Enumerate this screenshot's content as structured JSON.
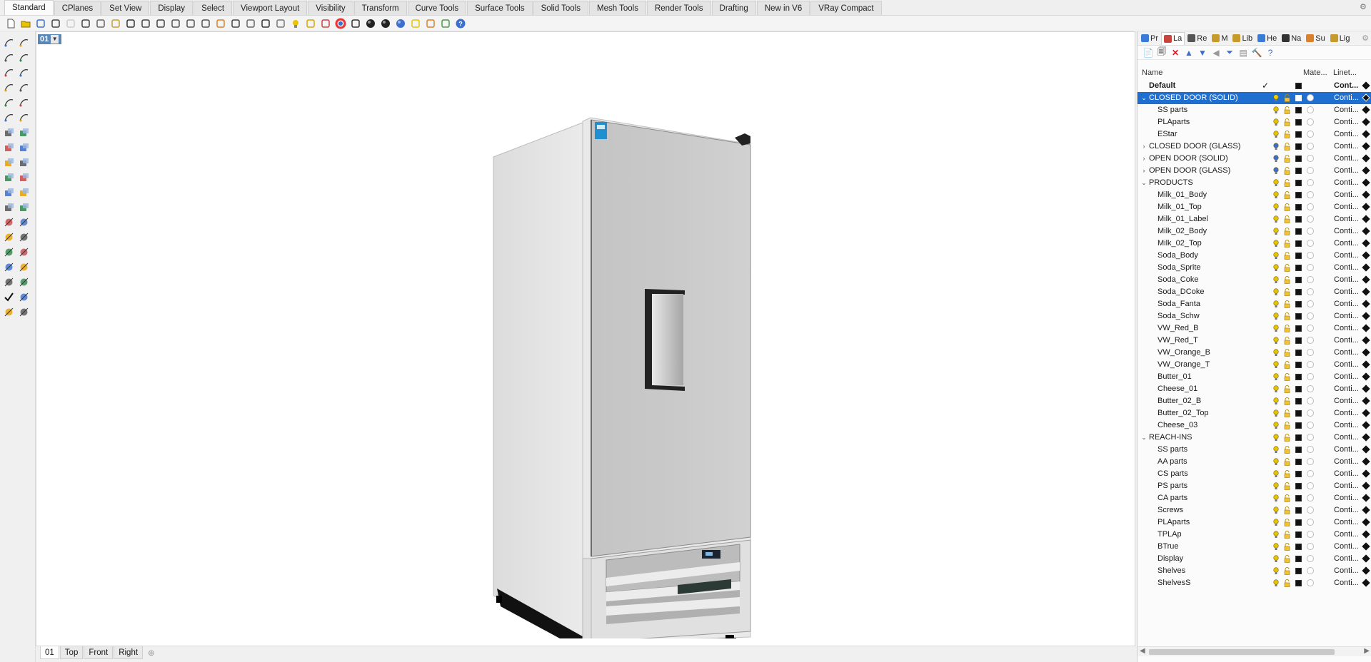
{
  "tabs": [
    "Standard",
    "CPlanes",
    "Set View",
    "Display",
    "Select",
    "Viewport Layout",
    "Visibility",
    "Transform",
    "Curve Tools",
    "Surface Tools",
    "Solid Tools",
    "Mesh Tools",
    "Render Tools",
    "Drafting",
    "New in V6",
    "VRay Compact"
  ],
  "active_tab": "Standard",
  "viewport": {
    "label": "01"
  },
  "viewport_tabs": [
    "01",
    "Top",
    "Front",
    "Right"
  ],
  "panel_tabs": [
    {
      "label": "Pr",
      "icon": "properties-icon",
      "color": "#3a7bd5"
    },
    {
      "label": "La",
      "icon": "layers-icon",
      "color": "#c8443c"
    },
    {
      "label": "Re",
      "icon": "render-icon",
      "color": "#555555"
    },
    {
      "label": "M",
      "icon": "materials-icon",
      "color": "#c69b2b"
    },
    {
      "label": "Lib",
      "icon": "library-icon",
      "color": "#c69b2b"
    },
    {
      "label": "He",
      "icon": "help-icon",
      "color": "#3a7bd5"
    },
    {
      "label": "Na",
      "icon": "named-views-icon",
      "color": "#333333"
    },
    {
      "label": "Su",
      "icon": "sun-icon",
      "color": "#d9822b"
    },
    {
      "label": "Lig",
      "icon": "lights-icon",
      "color": "#c69b2b"
    }
  ],
  "layers_header": {
    "name": "Name",
    "material": "Mate...",
    "linetype": "Linet..."
  },
  "layers": [
    {
      "name": "Default",
      "level": 0,
      "expand": "",
      "bold": true,
      "current": true,
      "linetype": "Cont...",
      "bulb": "#e8c400"
    },
    {
      "name": "CLOSED DOOR (SOLID)",
      "level": 0,
      "expand": "v",
      "selected": true,
      "linetype": "Conti...",
      "bulb": "#e8c400"
    },
    {
      "name": "SS parts",
      "level": 1,
      "expand": "",
      "linetype": "Conti...",
      "bulb": "#e8c400"
    },
    {
      "name": "PLAparts",
      "level": 1,
      "expand": "",
      "linetype": "Conti...",
      "bulb": "#e8c400"
    },
    {
      "name": "EStar",
      "level": 1,
      "expand": "",
      "linetype": "Conti...",
      "bulb": "#e8c400"
    },
    {
      "name": "CLOSED DOOR (GLASS)",
      "level": 0,
      "expand": ">",
      "linetype": "Conti...",
      "bulb": "#3a6fd0"
    },
    {
      "name": "OPEN DOOR (SOLID)",
      "level": 0,
      "expand": ">",
      "linetype": "Conti...",
      "bulb": "#3a6fd0"
    },
    {
      "name": "OPEN DOOR (GLASS)",
      "level": 0,
      "expand": ">",
      "linetype": "Conti...",
      "bulb": "#3a6fd0"
    },
    {
      "name": "PRODUCTS",
      "level": 0,
      "expand": "v",
      "linetype": "Conti...",
      "bulb": "#e8c400"
    },
    {
      "name": "Milk_01_Body",
      "level": 1,
      "expand": "",
      "linetype": "Conti...",
      "bulb": "#e8c400"
    },
    {
      "name": "Milk_01_Top",
      "level": 1,
      "expand": "",
      "linetype": "Conti...",
      "bulb": "#e8c400"
    },
    {
      "name": "Milk_01_Label",
      "level": 1,
      "expand": "",
      "linetype": "Conti...",
      "bulb": "#e8c400"
    },
    {
      "name": "Milk_02_Body",
      "level": 1,
      "expand": "",
      "linetype": "Conti...",
      "bulb": "#e8c400"
    },
    {
      "name": "Milk_02_Top",
      "level": 1,
      "expand": "",
      "linetype": "Conti...",
      "bulb": "#e8c400"
    },
    {
      "name": "Soda_Body",
      "level": 1,
      "expand": "",
      "linetype": "Conti...",
      "bulb": "#e8c400"
    },
    {
      "name": "Soda_Sprite",
      "level": 1,
      "expand": "",
      "linetype": "Conti...",
      "bulb": "#e8c400"
    },
    {
      "name": "Soda_Coke",
      "level": 1,
      "expand": "",
      "linetype": "Conti...",
      "bulb": "#e8c400"
    },
    {
      "name": "Soda_DCoke",
      "level": 1,
      "expand": "",
      "linetype": "Conti...",
      "bulb": "#e8c400"
    },
    {
      "name": "Soda_Fanta",
      "level": 1,
      "expand": "",
      "linetype": "Conti...",
      "bulb": "#e8c400"
    },
    {
      "name": "Soda_Schw",
      "level": 1,
      "expand": "",
      "linetype": "Conti...",
      "bulb": "#e8c400"
    },
    {
      "name": "VW_Red_B",
      "level": 1,
      "expand": "",
      "linetype": "Conti...",
      "bulb": "#e8c400"
    },
    {
      "name": "VW_Red_T",
      "level": 1,
      "expand": "",
      "linetype": "Conti...",
      "bulb": "#e8c400"
    },
    {
      "name": "VW_Orange_B",
      "level": 1,
      "expand": "",
      "linetype": "Conti...",
      "bulb": "#e8c400"
    },
    {
      "name": "VW_Orange_T",
      "level": 1,
      "expand": "",
      "linetype": "Conti...",
      "bulb": "#e8c400"
    },
    {
      "name": "Butter_01",
      "level": 1,
      "expand": "",
      "linetype": "Conti...",
      "bulb": "#e8c400"
    },
    {
      "name": "Cheese_01",
      "level": 1,
      "expand": "",
      "linetype": "Conti...",
      "bulb": "#e8c400"
    },
    {
      "name": "Butter_02_B",
      "level": 1,
      "expand": "",
      "linetype": "Conti...",
      "bulb": "#e8c400"
    },
    {
      "name": "Butter_02_Top",
      "level": 1,
      "expand": "",
      "linetype": "Conti...",
      "bulb": "#e8c400"
    },
    {
      "name": "Cheese_03",
      "level": 1,
      "expand": "",
      "linetype": "Conti...",
      "bulb": "#e8c400"
    },
    {
      "name": "REACH-INS",
      "level": 0,
      "expand": "v",
      "linetype": "Conti...",
      "bulb": "#e8c400"
    },
    {
      "name": "SS parts",
      "level": 1,
      "expand": "",
      "linetype": "Conti...",
      "bulb": "#e8c400"
    },
    {
      "name": "AA parts",
      "level": 1,
      "expand": "",
      "linetype": "Conti...",
      "bulb": "#e8c400"
    },
    {
      "name": "CS parts",
      "level": 1,
      "expand": "",
      "linetype": "Conti...",
      "bulb": "#e8c400"
    },
    {
      "name": "PS parts",
      "level": 1,
      "expand": "",
      "linetype": "Conti...",
      "bulb": "#e8c400"
    },
    {
      "name": "CA parts",
      "level": 1,
      "expand": "",
      "linetype": "Conti...",
      "bulb": "#e8c400"
    },
    {
      "name": "Screws",
      "level": 1,
      "expand": "",
      "linetype": "Conti...",
      "bulb": "#e8c400"
    },
    {
      "name": "PLAparts",
      "level": 1,
      "expand": "",
      "linetype": "Conti...",
      "bulb": "#e8c400"
    },
    {
      "name": "TPLAp",
      "level": 1,
      "expand": "",
      "linetype": "Conti...",
      "bulb": "#e8c400"
    },
    {
      "name": "BTrue",
      "level": 1,
      "expand": "",
      "linetype": "Conti...",
      "bulb": "#e8c400"
    },
    {
      "name": "Display",
      "level": 1,
      "expand": "",
      "linetype": "Conti...",
      "bulb": "#e8c400"
    },
    {
      "name": "Shelves",
      "level": 1,
      "expand": "",
      "linetype": "Conti...",
      "bulb": "#e8c400"
    },
    {
      "name": "ShelvesS",
      "level": 1,
      "expand": "",
      "linetype": "Conti...",
      "bulb": "#e8c400"
    }
  ],
  "colors": {
    "selection": "#1f6fd0",
    "viewport_label": "#5a86b8"
  }
}
